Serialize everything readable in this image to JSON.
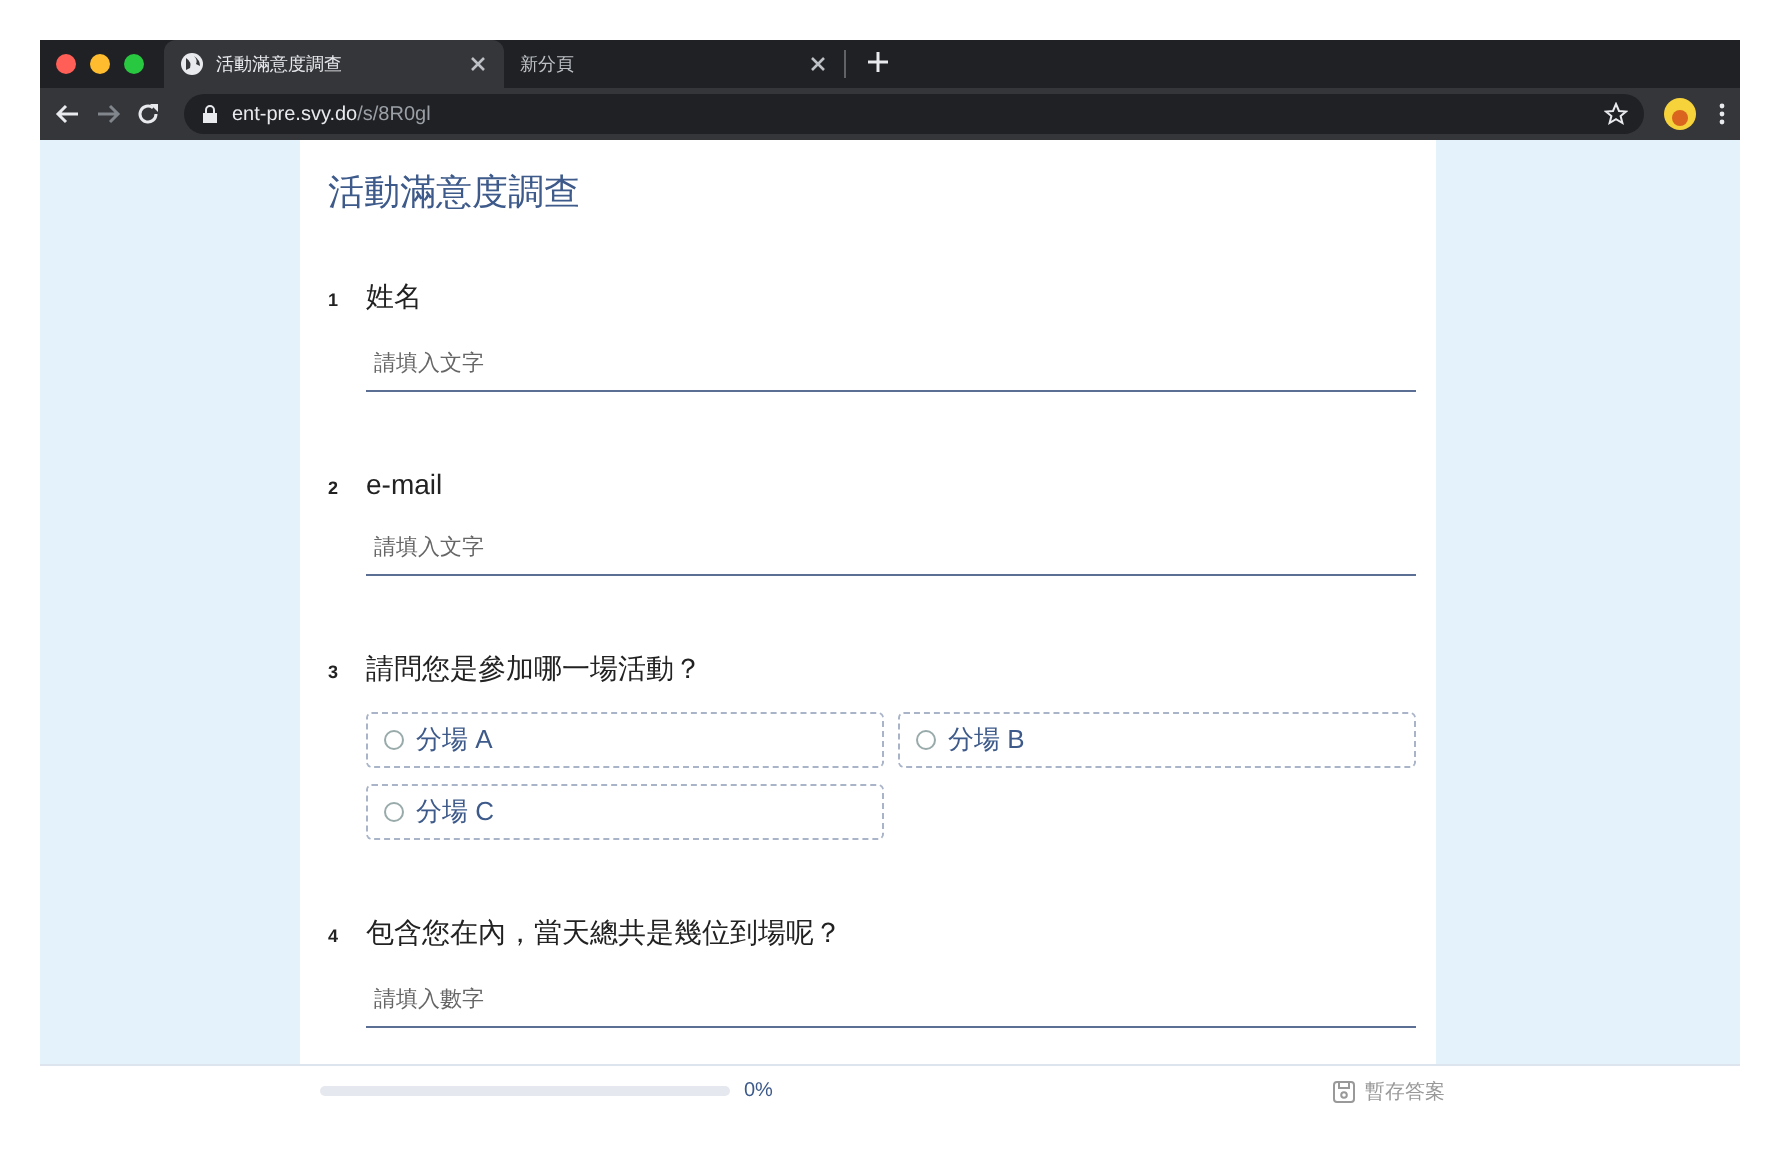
{
  "browser": {
    "tabs": [
      {
        "title": "活動滿意度調查",
        "selected": true
      },
      {
        "title": "新分頁",
        "selected": false
      }
    ],
    "address": {
      "host": "ent-pre.svy.do",
      "path": "/s/8R0gl"
    }
  },
  "survey": {
    "title": "活動滿意度調查",
    "questions": [
      {
        "number": "1",
        "label": "姓名",
        "kind": "text",
        "placeholder": "請填入文字"
      },
      {
        "number": "2",
        "label": "e-mail",
        "kind": "text",
        "placeholder": "請填入文字"
      },
      {
        "number": "3",
        "label": "請問您是參加哪一場活動？",
        "kind": "choice",
        "options": [
          {
            "label": "分場 A",
            "selected": false
          },
          {
            "label": "分場 B",
            "selected": false
          },
          {
            "label": "分場 C",
            "selected": false
          }
        ]
      },
      {
        "number": "4",
        "label": "包含您在內，當天總共是幾位到場呢？",
        "kind": "text",
        "placeholder": "請填入數字"
      }
    ]
  },
  "footer": {
    "level": 0,
    "progress": "0%",
    "save": "暫存答案"
  }
}
